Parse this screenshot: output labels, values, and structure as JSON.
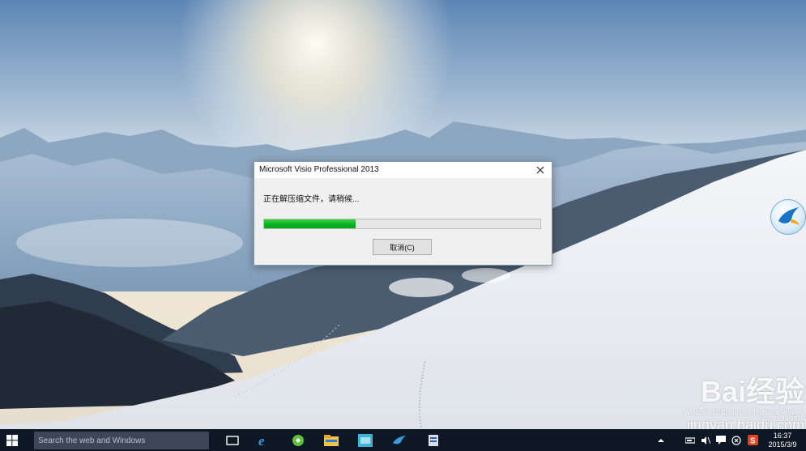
{
  "dialog": {
    "title": "Microsoft Visio Professional 2013",
    "message": "正在解压缩文件，请稍候...",
    "progress_fraction": 0.33,
    "cancel_label": "取消(C)"
  },
  "taskbar": {
    "search_placeholder": "Search the web and Windows",
    "pinned_apps": [
      "task-view-icon",
      "internet-explorer-icon",
      "store-icon",
      "file-explorer-icon",
      "media-icon",
      "bird-app-icon",
      "installer-icon"
    ],
    "tray_icons": [
      "chevron-up-icon",
      "network-icon",
      "volume-icon",
      "action-center-icon",
      "close-circle-icon",
      "sogou-icon"
    ],
    "time": "16:37",
    "date": "2015/3/9"
  },
  "watermark": {
    "brand": "Bai经验",
    "line1": "Windows 10 Enterprise Technical Preview",
    "line2": "opy. Build 9926",
    "url": "jingyan.baidu.com"
  },
  "colors": {
    "taskbar": "#0e1724",
    "progress_green": "#06b025",
    "dialog_bg": "#f0f0f0"
  }
}
